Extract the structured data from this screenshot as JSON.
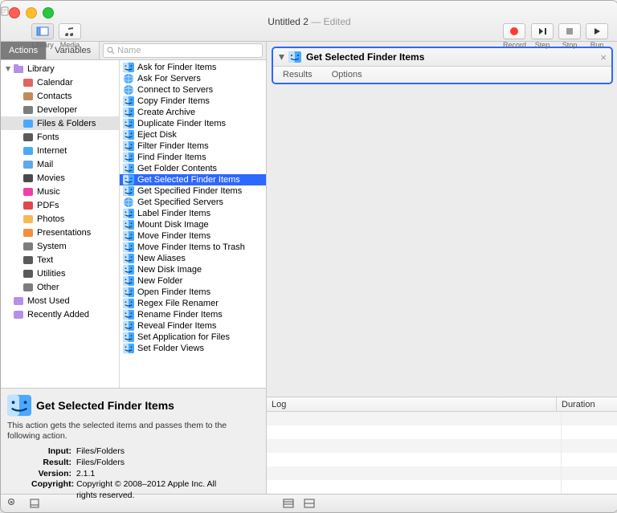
{
  "window": {
    "filename": "Untitled 2",
    "status": "Edited"
  },
  "toolbar": {
    "library": "Library",
    "media": "Media",
    "record": "Record",
    "step": "Step",
    "stop": "Stop",
    "run": "Run"
  },
  "sidebar_tabs": {
    "actions": "Actions",
    "variables": "Variables"
  },
  "search": {
    "placeholder": "Name"
  },
  "library": {
    "root": "Library",
    "items": [
      "Calendar",
      "Contacts",
      "Developer",
      "Files & Folders",
      "Fonts",
      "Internet",
      "Mail",
      "Movies",
      "Music",
      "PDFs",
      "Photos",
      "Presentations",
      "System",
      "Text",
      "Utilities",
      "Other"
    ],
    "selected": "Files & Folders",
    "bottom": [
      "Most Used",
      "Recently Added"
    ]
  },
  "actions": {
    "items": [
      "Ask for Finder Items",
      "Ask For Servers",
      "Connect to Servers",
      "Copy Finder Items",
      "Create Archive",
      "Duplicate Finder Items",
      "Eject Disk",
      "Filter Finder Items",
      "Find Finder Items",
      "Get Folder Contents",
      "Get Selected Finder Items",
      "Get Specified Finder Items",
      "Get Specified Servers",
      "Label Finder Items",
      "Mount Disk Image",
      "Move Finder Items",
      "Move Finder Items to Trash",
      "New Aliases",
      "New Disk Image",
      "New Folder",
      "Open Finder Items",
      "Regex File Renamer",
      "Rename Finder Items",
      "Reveal Finder Items",
      "Set Application for Files",
      "Set Folder Views"
    ],
    "selected": "Get Selected Finder Items"
  },
  "description": {
    "title": "Get Selected Finder Items",
    "body": "This action gets the selected items and passes them to the following action.",
    "input_label": "Input:",
    "input_value": "Files/Folders",
    "result_label": "Result:",
    "result_value": "Files/Folders",
    "version_label": "Version:",
    "version_value": "2.1.1",
    "copyright_label": "Copyright:",
    "copyright_value": "Copyright © 2008–2012 Apple Inc.  All rights reserved."
  },
  "workflow": {
    "step_title": "Get Selected Finder Items",
    "subtabs": {
      "results": "Results",
      "options": "Options"
    }
  },
  "log": {
    "columns": {
      "log": "Log",
      "duration": "Duration"
    }
  }
}
